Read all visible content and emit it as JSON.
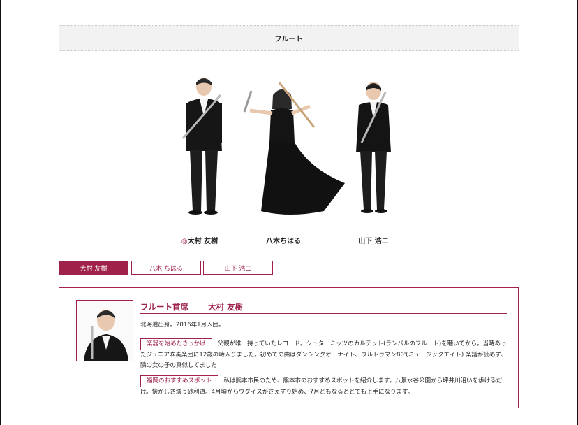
{
  "section": {
    "title": "フルート"
  },
  "members": [
    {
      "name": "大村 友樹",
      "mark": "◎"
    },
    {
      "name": "八木ちはる",
      "mark": ""
    },
    {
      "name": "山下 浩二",
      "mark": ""
    }
  ],
  "tabs": [
    {
      "label": "大村 友樹",
      "active": true
    },
    {
      "label": "八木 ちはる",
      "active": false
    },
    {
      "label": "山下 浩二",
      "active": false
    }
  ],
  "profile": {
    "role": "フルート首席",
    "name": "大村 友樹",
    "origin": "北海道出身。2016年1月入団。",
    "q1_label": "楽器を始めたきっかけ",
    "q1_text": "父親が唯一持っていたレコード。シュターミッツのカルテット(ランパルのフルート)を聴いてから。当時あったジュニア吹奏楽団に12歳の時入りました。初めての曲はダンシングオーナイト、ウルトラマン80'(ミュージックエイト) 楽譜が読めず、隣の女の子の真似してました",
    "q2_label": "福岡のおすすめスポット",
    "q2_text": "私は熊本市民のため、熊本市のおすすめスポットを紹介します。八景水谷公園から坪井川沿いを歩けるだけ。懐かしさ漂う砂利道。4月頃からウグイスがさえずり始め、7月ともなるととても上手になります。"
  },
  "colors": {
    "accent": "#a0224a",
    "header_bg": "#f2f2f2"
  }
}
